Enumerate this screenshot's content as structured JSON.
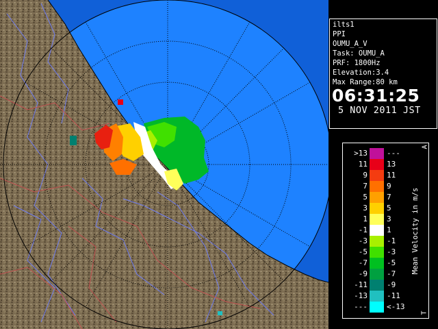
{
  "info": {
    "site": "ilts1",
    "scan_type": "PPI",
    "product": "OUMU_A_V",
    "task": "Task: OUMU_A",
    "prf": "PRF: 1800Hz",
    "elevation": "Elevation:3.4",
    "max_range": "Max Range:80 km",
    "time": "06:31:25",
    "date": "5 NOV 2011 JST"
  },
  "legend": {
    "title": "Mean Velocity in m/s",
    "corner_top": "A",
    "corner_bottom": "T",
    "rows": [
      {
        "left": ">13",
        "right": "---",
        "color": "#c0119a"
      },
      {
        "left": "11",
        "right": "13",
        "color": "#e80018"
      },
      {
        "left": "9",
        "right": "11",
        "color": "#f43c10"
      },
      {
        "left": "7",
        "right": "9",
        "color": "#ff7000"
      },
      {
        "left": "5",
        "right": "7",
        "color": "#ffa000"
      },
      {
        "left": "3",
        "right": "5",
        "color": "#ffd000"
      },
      {
        "left": "1",
        "right": "3",
        "color": "#ffff5a"
      },
      {
        "left": "-1",
        "right": "1",
        "color": "#ffffff"
      },
      {
        "left": "-3",
        "right": "-1",
        "color": "#a8f000"
      },
      {
        "left": "-5",
        "right": "-3",
        "color": "#40e000"
      },
      {
        "left": "-7",
        "right": "-5",
        "color": "#00c020"
      },
      {
        "left": "-9",
        "right": "-7",
        "color": "#00a040"
      },
      {
        "left": "-11",
        "right": "-9",
        "color": "#008070"
      },
      {
        "left": "-13",
        "right": "-11",
        "color": "#20c0c0"
      },
      {
        "left": "---",
        "right": "<-13",
        "color": "#00ffff"
      }
    ]
  },
  "colors": {
    "sea": "#1e82ff",
    "outer_sea": "#1060d8",
    "land": "#7a6a4e",
    "rivers": "#6e7cf0",
    "boundaries": "#c05050",
    "range_rings": "#000000"
  }
}
